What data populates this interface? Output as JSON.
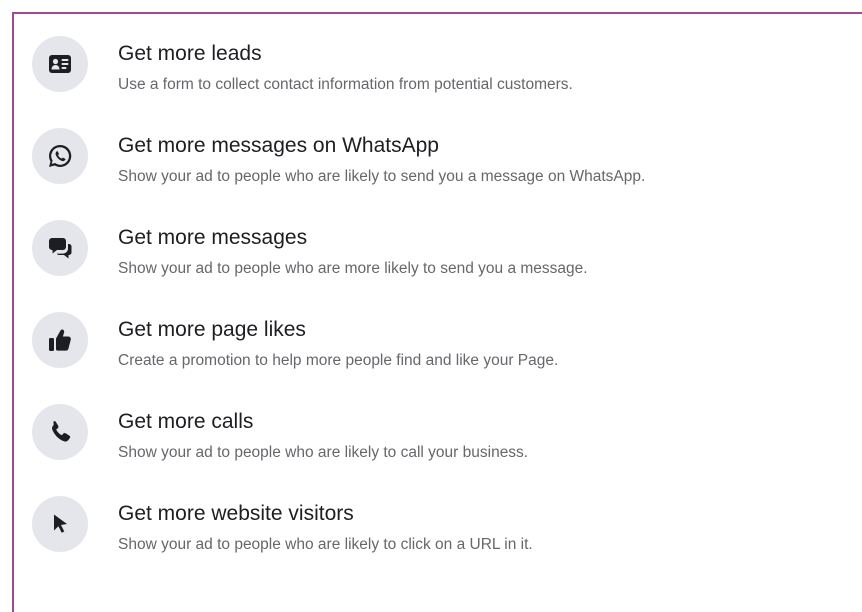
{
  "objectives": [
    {
      "icon": "contact-card-icon",
      "title": "Get more leads",
      "description": "Use a form to collect contact information from potential customers."
    },
    {
      "icon": "whatsapp-icon",
      "title": "Get more messages on WhatsApp",
      "description": "Show your ad to people who are likely to send you a message on WhatsApp."
    },
    {
      "icon": "chat-bubbles-icon",
      "title": "Get more messages",
      "description": "Show your ad to people who are more likely to send you a message."
    },
    {
      "icon": "thumbs-up-icon",
      "title": "Get more page likes",
      "description": "Create a promotion to help more people find and like your Page."
    },
    {
      "icon": "phone-icon",
      "title": "Get more calls",
      "description": "Show your ad to people who are likely to call your business."
    },
    {
      "icon": "cursor-icon",
      "title": "Get more website visitors",
      "description": "Show your ad to people who are likely to click on a URL in it."
    }
  ],
  "colors": {
    "frame_border": "#a8478c",
    "icon_background": "#e4e6eb",
    "icon_fill": "#1c1e21",
    "title_text": "#1c1e21",
    "description_text": "#65676b"
  }
}
